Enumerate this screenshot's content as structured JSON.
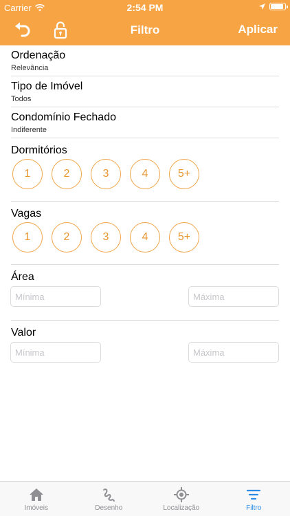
{
  "status_bar": {
    "carrier": "Carrier",
    "time": "2:54 PM",
    "battery_level": 0.95
  },
  "nav": {
    "title": "Filtro",
    "apply_label": "Aplicar",
    "undo_icon": "undo-icon",
    "lock_icon": "lock-icon"
  },
  "filters": {
    "ordenacao": {
      "label": "Ordenação",
      "value": "Relevância"
    },
    "tipo": {
      "label": "Tipo de Imóvel",
      "value": "Todos"
    },
    "condominio": {
      "label": "Condomínio Fechado",
      "value": "Indiferente"
    }
  },
  "dormitorios": {
    "label": "Dormitórios",
    "options": [
      "1",
      "2",
      "3",
      "4",
      "5+"
    ]
  },
  "vagas": {
    "label": "Vagas",
    "options": [
      "1",
      "2",
      "3",
      "4",
      "5+"
    ]
  },
  "area": {
    "label": "Área",
    "min_placeholder": "Mínima",
    "max_placeholder": "Máxima"
  },
  "valor": {
    "label": "Valor",
    "min_placeholder": "Mínima",
    "max_placeholder": "Máxima"
  },
  "tabs": [
    {
      "label": "Imóveis",
      "icon": "home-icon"
    },
    {
      "label": "Desenho",
      "icon": "draw-icon"
    },
    {
      "label": "Localização",
      "icon": "location-target-icon"
    },
    {
      "label": "Filtro",
      "icon": "filter-icon",
      "active": true
    }
  ],
  "colors": {
    "accent": "#F7A445",
    "chip_border": "#F0A447",
    "tab_active": "#2A8CE6",
    "tab_inactive": "#8e8e93"
  }
}
